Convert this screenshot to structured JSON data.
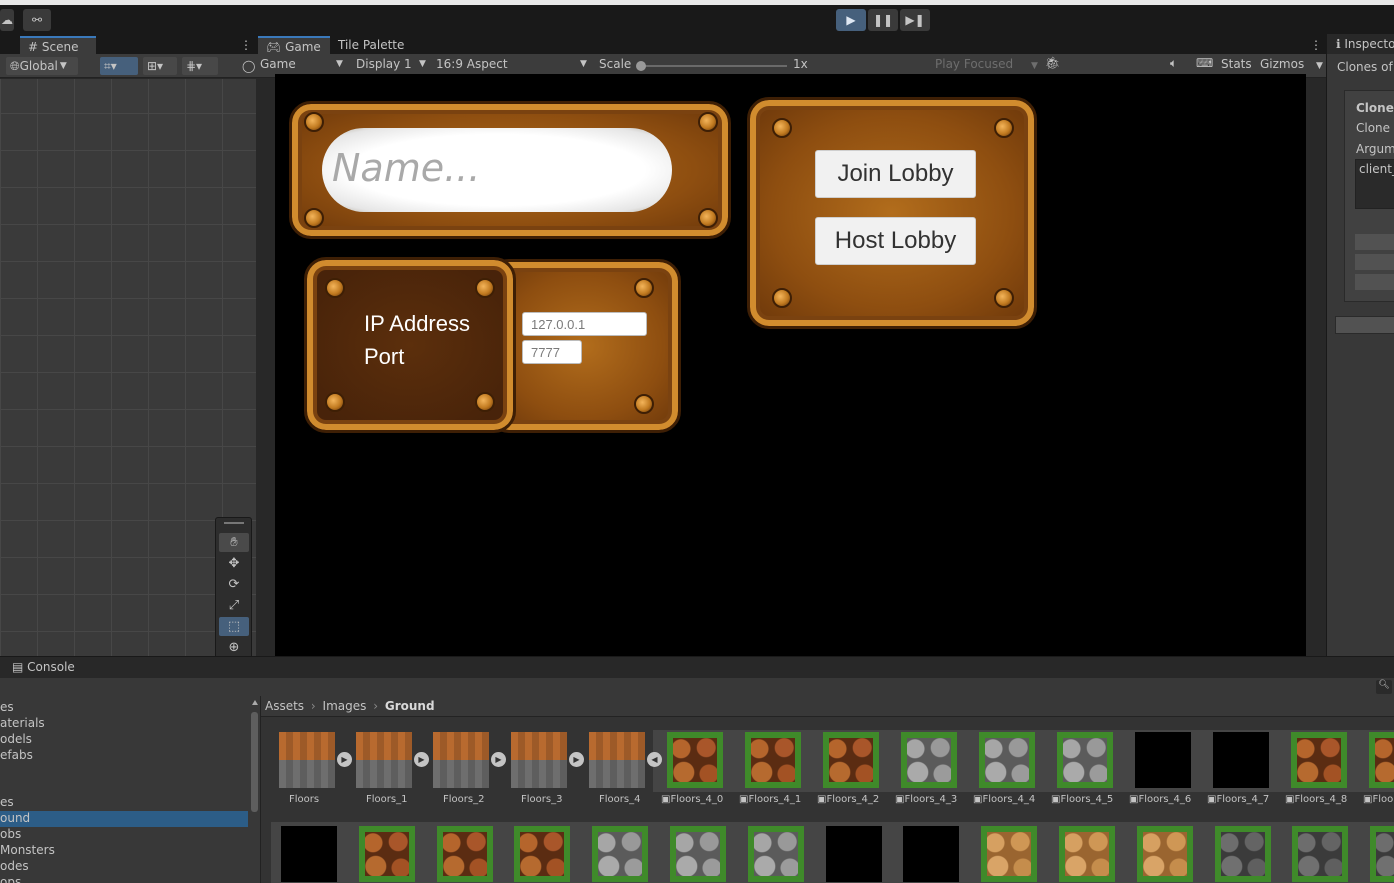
{
  "toolbar": {
    "play_icon": "play-icon",
    "pause_icon": "pause-icon",
    "step_icon": "step-icon"
  },
  "scene_panel": {
    "tab_label": "Scene",
    "global_label": "Global",
    "tools": [
      "hand-icon",
      "move-icon",
      "rotate-icon",
      "scale-icon",
      "rect-icon",
      "transform-icon"
    ]
  },
  "game_panel": {
    "tab_game": "Game",
    "tab_tile_palette": "Tile Palette",
    "view_select": "Game",
    "display_select": "Display 1",
    "aspect_select": "16:9 Aspect",
    "scale_label": "Scale",
    "scale_value": "1x",
    "scale_level": 0,
    "play_focused": "Play Focused",
    "stats_label": "Stats",
    "gizmos_label": "Gizmos"
  },
  "game_ui": {
    "name_placeholder": "Name...",
    "join_button": "Join Lobby",
    "host_button": "Host Lobby",
    "ip_label": "IP Address",
    "port_label": "Port",
    "ip_value": "127.0.0.1",
    "port_value": "7777"
  },
  "inspector": {
    "tab_label": "Inspecto",
    "clones_text": "Clones of t",
    "clone_heading": "Clone C",
    "clone_field": "Clone p",
    "arguments_label": "Argume",
    "arguments_value": "client_"
  },
  "console": {
    "tab_label": "Console"
  },
  "project": {
    "tree": [
      {
        "label": "es",
        "selected": false
      },
      {
        "label": "aterials",
        "selected": false
      },
      {
        "label": "odels",
        "selected": false
      },
      {
        "label": "efabs",
        "selected": false
      },
      {
        "label": "",
        "selected": false
      },
      {
        "label": "",
        "selected": false
      },
      {
        "label": "es",
        "selected": false
      },
      {
        "label": "ound",
        "selected": true
      },
      {
        "label": "obs",
        "selected": false
      },
      {
        "label": "Monsters",
        "selected": false
      },
      {
        "label": "odes",
        "selected": false
      },
      {
        "label": "ops",
        "selected": false
      }
    ],
    "breadcrumb": [
      "Assets",
      "Images",
      "Ground"
    ],
    "assets_row1": [
      "Floors",
      "Floors_1",
      "Floors_2",
      "Floors_3",
      "Floors_4",
      "Floors_4_0",
      "Floors_4_1",
      "Floors_4_2",
      "Floors_4_3",
      "Floors_4_4",
      "Floors_4_5",
      "Floors_4_6",
      "Floors_4_7",
      "Floors_4_8",
      "Floo"
    ]
  }
}
